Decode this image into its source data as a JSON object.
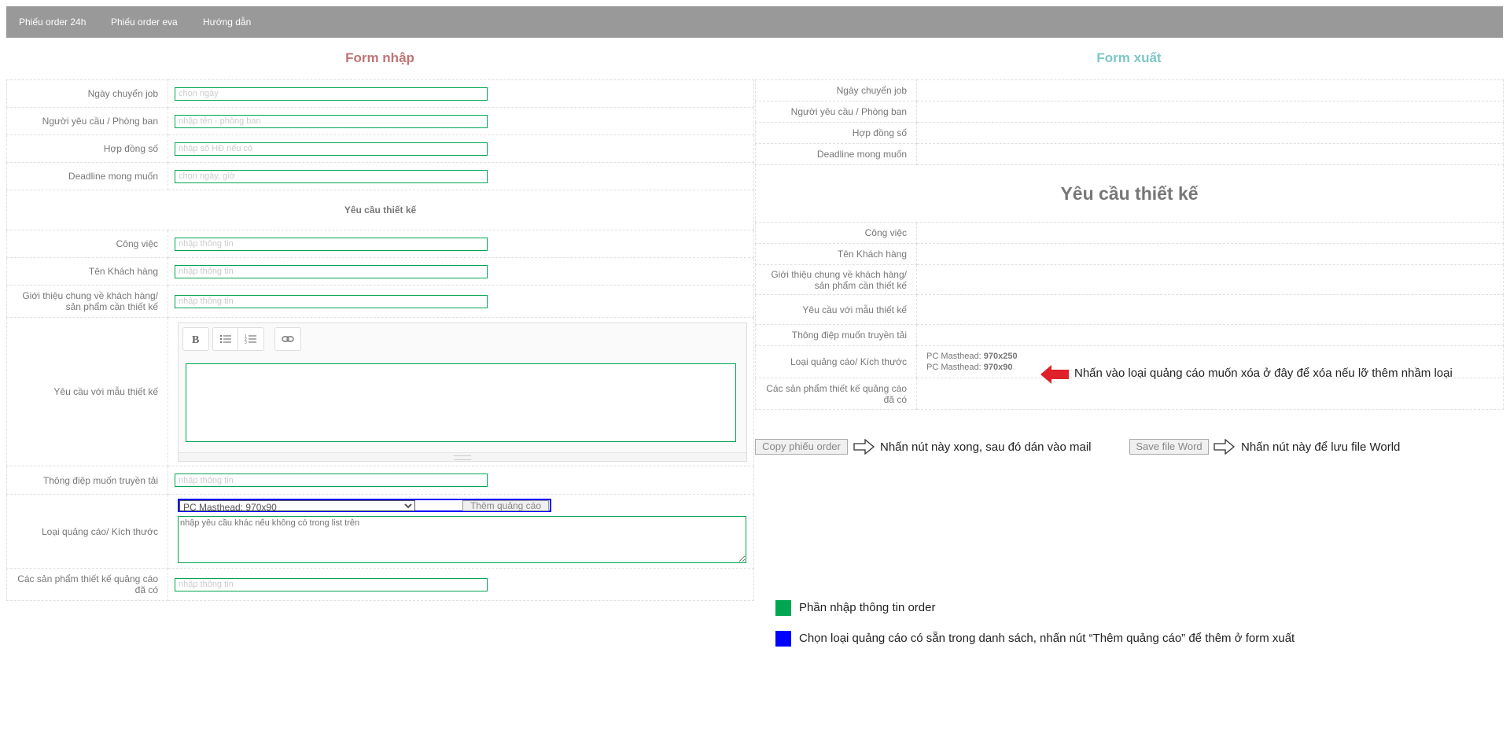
{
  "nav": {
    "items": [
      "Phiếu order 24h",
      "Phiếu order eva",
      "Hướng dẫn"
    ]
  },
  "form_in": {
    "title": "Form nhập",
    "rows": [
      {
        "label": "Ngày chuyển job",
        "placeholder": "chọn ngày"
      },
      {
        "label": "Người yêu cầu / Phòng ban",
        "placeholder": "nhập tên - phòng ban"
      },
      {
        "label": "Hợp đồng số",
        "placeholder": "nhập số HĐ nếu có"
      },
      {
        "label": "Deadline mong muốn",
        "placeholder": "chọn ngày, giờ"
      }
    ],
    "section": "Yêu cầu thiết kế",
    "rows2": [
      {
        "label": "Công việc",
        "placeholder": "nhập thông tin"
      },
      {
        "label": "Tên Khách hàng",
        "placeholder": "nhập thông tin"
      },
      {
        "label": "Giới thiệu chung về khách hàng/ sản phẩm cần thiết kế",
        "placeholder": "nhập thông tin"
      }
    ],
    "editor_label": "Yêu cầu với mẫu thiết kế",
    "message": {
      "label": "Thông điệp muốn truyền tải",
      "placeholder": "nhập thông tin"
    },
    "ad": {
      "label": "Loại quảng cáo/ Kích thước",
      "select_value": "PC Masthead: 970x90",
      "add_button": "Thêm quảng cáo",
      "textarea_placeholder": "nhập yêu cầu khác nếu không có trong list trên"
    },
    "existing": {
      "label": "Các sản phẩm thiết kế quảng cáo đã có",
      "placeholder": "nhập thông tin"
    }
  },
  "form_out": {
    "title": "Form xuất",
    "rows": [
      "Ngày chuyển job",
      "Người yêu cầu / Phòng ban",
      "Hợp đồng số",
      "Deadline mong muốn"
    ],
    "section": "Yêu cầu thiết kế",
    "rows2": [
      "Công việc",
      "Tên Khách hàng",
      "Giới thiệu chung về khách hàng/ sản phẩm cần thiết kế",
      "Yêu cầu với mẫu thiết kế",
      "Thông điệp muốn truyền tải"
    ],
    "ad_label": "Loại quảng cáo/ Kích thước",
    "ads": [
      {
        "name": "PC Masthead: ",
        "size": "970x250"
      },
      {
        "name": "PC Masthead: ",
        "size": "970x90"
      }
    ],
    "existing_label": "Các sản phẩm thiết kế quảng cáo đã có"
  },
  "notes": {
    "delete_hint": "Nhấn vào loại quảng cáo muốn xóa ở đây để xóa nếu lỡ thêm nhầm loại",
    "copy_button": "Copy phiếu order",
    "copy_hint": "Nhấn nút này xong, sau đó dán vào mail",
    "save_button": "Save file Word",
    "save_hint": "Nhấn nút này để lưu file World"
  },
  "legend": [
    {
      "color": "#00a651",
      "text": "Phần nhập thông tin order"
    },
    {
      "color": "#0000ff",
      "text": "Chọn loại quảng cáo có sẵn trong danh sách, nhấn nút “Thêm quảng cáo” để thêm ở form xuất"
    }
  ],
  "colors": {
    "input_border": "#00a651",
    "select_border": "#0000ff",
    "arrow": "#e0202a",
    "nav": "#999999"
  }
}
